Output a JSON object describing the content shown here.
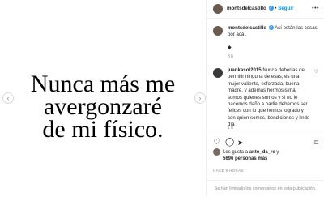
{
  "media": {
    "quote_lines": [
      "Nunca más me",
      "avergonzaré",
      "de mi físico."
    ],
    "prev_icon": "chevron-left-icon",
    "next_icon": "chevron-right-icon"
  },
  "header": {
    "username": "montsdelcastillo",
    "separator": "•",
    "follow_label": "Seguir",
    "more_label": "•••"
  },
  "caption": {
    "username": "montsdelcastillo",
    "text": "Así están las cosas por acá .",
    "extra": "◆",
    "time": "8 h"
  },
  "comments": [
    {
      "username": "juankasol2015",
      "text": "Nunca deberías de permitir ninguna de esas, es una mujer valiente, esforzada, buena madre, y además hermosísima, somos quienes somos y si no le hacemos daño a nadie debemos ser felices con lo que hemos logrado y con quien somos, bendiciones y lindo día",
      "time": "1 h"
    }
  ],
  "likes": {
    "prefix": "Les gusta a",
    "user": "anto_da_re",
    "middle": "y",
    "count": "5696 personas más"
  },
  "post_time": "HACE 8 HORAS",
  "comments_limited": "Se han limitado los comentarios en esta publicación.",
  "colors": {
    "accent": "#0095f6",
    "verified": "#3897f0",
    "muted": "#8e8e8e"
  }
}
